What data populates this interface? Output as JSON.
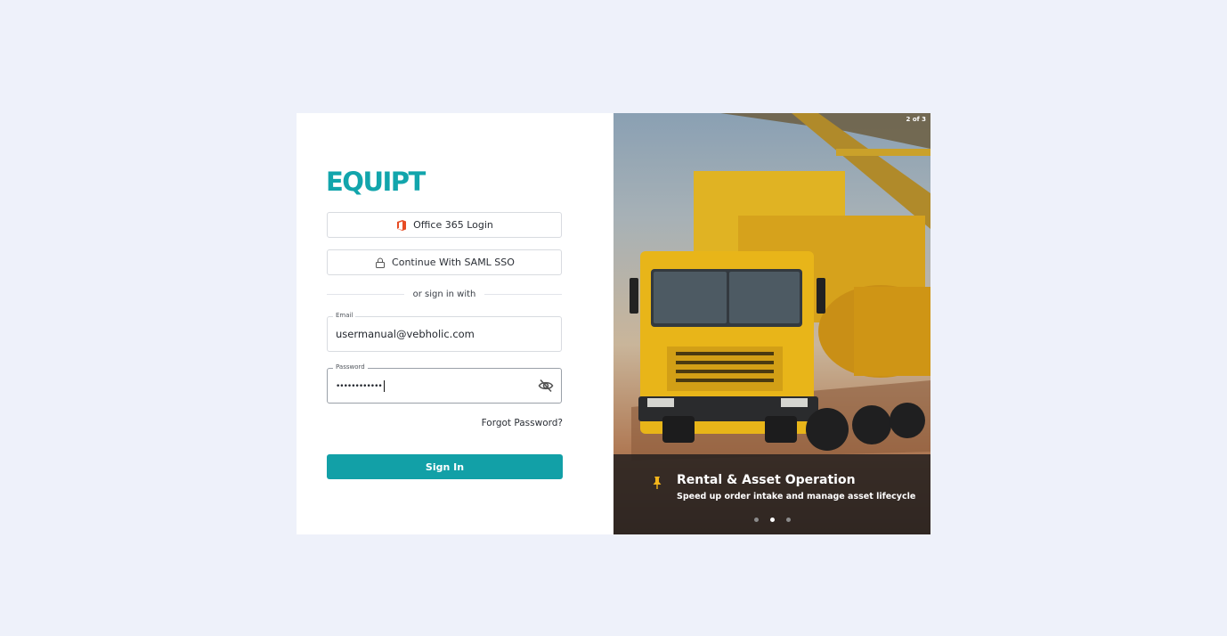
{
  "logo": {
    "text": "EQUIPT"
  },
  "login_buttons": {
    "office365": "Office 365 Login",
    "saml": "Continue With SAML SSO"
  },
  "divider_text": "or sign in with",
  "email": {
    "label": "Email",
    "value": "usermanual@vebholic.com"
  },
  "password": {
    "label": "Password",
    "value": "••••••••••••"
  },
  "forgot_password": "Forgot Password?",
  "sign_in": "Sign In",
  "carousel": {
    "counter": "2 of 3",
    "title": "Rental & Asset Operation",
    "subtitle": "Speed up order intake and manage asset lifecycle",
    "slides": 3,
    "active_slide": 2
  },
  "colors": {
    "brand": "#12a5ac",
    "primary_button": "#12a0a7",
    "background": "#eef1fa"
  }
}
